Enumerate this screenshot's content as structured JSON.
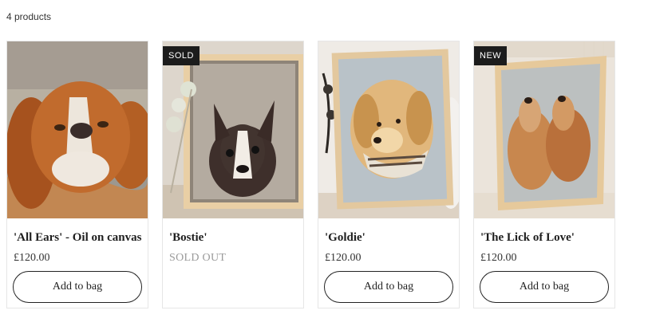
{
  "collection": {
    "product_count": "4 products"
  },
  "products": [
    {
      "title": "'All Ears' - Oil on canvas",
      "price": "£120.00",
      "badge": "",
      "button": "Add to bag"
    },
    {
      "title": "'Bostie'",
      "price": "SOLD OUT",
      "badge": "SOLD",
      "button": ""
    },
    {
      "title": "'Goldie'",
      "price": "£120.00",
      "badge": "",
      "button": "Add to bag"
    },
    {
      "title": "'The Lick of Love'",
      "price": "£120.00",
      "badge": "NEW",
      "button": "Add to bag"
    }
  ],
  "colors": {
    "badge_bg": "#1c1c1c",
    "button_border": "#222222",
    "sold_out_text": "#9a9a9a"
  }
}
